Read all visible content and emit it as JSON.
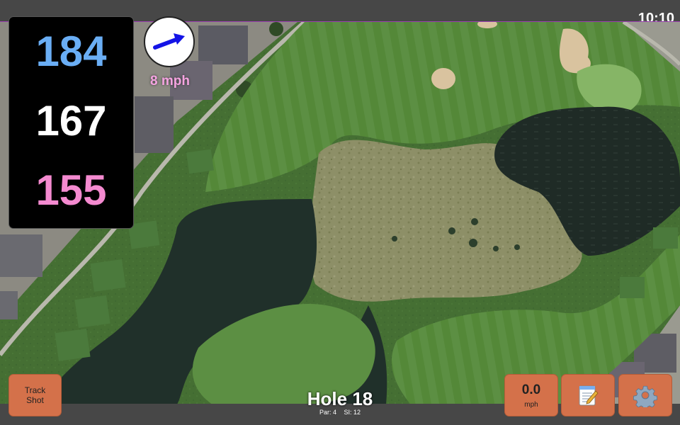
{
  "status_bar": {
    "time": "10:10"
  },
  "distances": {
    "back": "184",
    "middle": "167",
    "front": "155",
    "colors": {
      "back": "#6aaef5",
      "middle": "#ffffff",
      "front": "#f48ad0"
    }
  },
  "wind": {
    "speed": "8 mph",
    "direction_icon": "arrow-right-up-icon",
    "arrow_color": "#1414e6"
  },
  "hole": {
    "title": "Hole 18",
    "par": "Par: 4",
    "stroke_index": "SI: 12"
  },
  "buttons": {
    "track_shot_line1": "Track",
    "track_shot_line2": "Shot",
    "speed_value": "0.0",
    "speed_unit": "mph",
    "notes_icon": "notepad-icon",
    "settings_icon": "gear-icon",
    "button_color": "#d4714a"
  },
  "map": {
    "view": "satellite",
    "accent_border": "#9a3fb0"
  }
}
